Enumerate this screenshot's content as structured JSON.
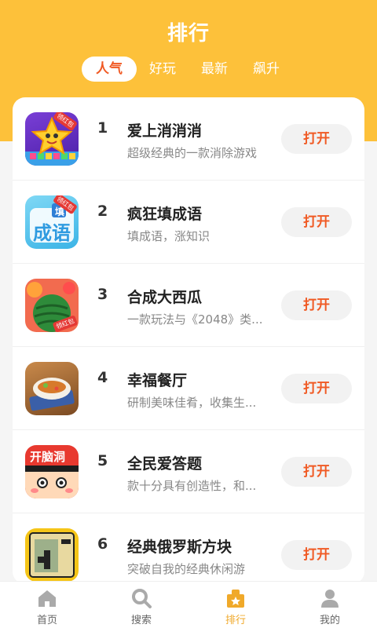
{
  "header": {
    "title": "排行"
  },
  "tabs": [
    {
      "label": "人气",
      "active": true
    },
    {
      "label": "好玩",
      "active": false
    },
    {
      "label": "最新",
      "active": false
    },
    {
      "label": "飙升",
      "active": false
    }
  ],
  "apps": [
    {
      "rank": "1",
      "name": "爱上消消消",
      "desc": "超级经典的一款消除游戏",
      "button": "打开",
      "icon": "star-candy-icon",
      "badge": "领红包"
    },
    {
      "rank": "2",
      "name": "疯狂填成语",
      "desc": "填成语，涨知识",
      "button": "打开",
      "icon": "idiom-game-icon",
      "badge": "领红包",
      "icon_text": "成语",
      "icon_tag": "填"
    },
    {
      "rank": "3",
      "name": "合成大西瓜",
      "desc": "一款玩法与《2048》类...",
      "button": "打开",
      "icon": "watermelon-icon",
      "badge": "领红包"
    },
    {
      "rank": "4",
      "name": "幸福餐厅",
      "desc": "研制美味佳肴，收集生...",
      "button": "打开",
      "icon": "restaurant-dish-icon"
    },
    {
      "rank": "5",
      "name": "全民爱答题",
      "desc": "款十分具有创造性，和...",
      "button": "打开",
      "icon": "quiz-cartoon-icon",
      "icon_text": "开脑洞"
    },
    {
      "rank": "6",
      "name": "经典俄罗斯方块",
      "desc": "突破自我的经典休闲游",
      "button": "打开",
      "icon": "tetris-icon"
    }
  ],
  "nav": [
    {
      "label": "首页",
      "icon": "home-icon",
      "active": false
    },
    {
      "label": "搜索",
      "icon": "search-icon",
      "active": false
    },
    {
      "label": "排行",
      "icon": "ranking-icon",
      "active": true
    },
    {
      "label": "我的",
      "icon": "user-icon",
      "active": false
    }
  ],
  "colors": {
    "header": "#fdc13a",
    "accent": "#f05a24",
    "nav_active": "#f0a92a"
  }
}
